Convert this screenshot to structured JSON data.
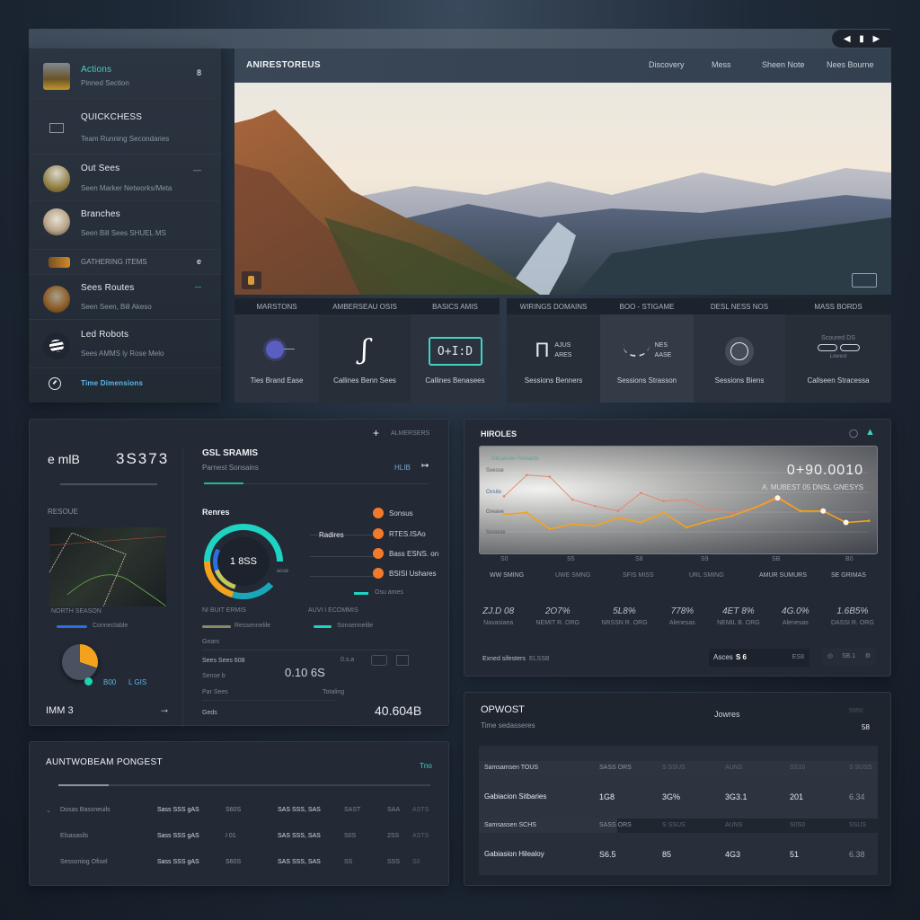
{
  "window": {
    "controls": [
      "prev",
      "stop",
      "next"
    ]
  },
  "sidebar": {
    "items": [
      {
        "title": "Actions",
        "subtitle": "Pinned Section",
        "badge": "8",
        "thumb": "cabin-photo",
        "accent": true
      },
      {
        "title": "QUICKCHESS",
        "subtitle": "Team Running Secondaries",
        "badge": "",
        "thumb": "device-icon"
      },
      {
        "title": "Out Sees",
        "subtitle": "Seen Marker Networks/Meta",
        "badge": "—",
        "thumb": "field-photo"
      },
      {
        "title": "Branches",
        "subtitle": "Seen Bill Sees SHUEL MS",
        "badge": "",
        "thumb": "tower-photo"
      },
      {
        "title": "GATHERING ITEMS",
        "subtitle": "",
        "badge": "e",
        "thumb": "campfire-photo",
        "small_caps": true
      },
      {
        "title": "Sees Routes",
        "subtitle": "Seen Seen, Bill Akeso",
        "badge": "—",
        "thumb": "market-photo"
      },
      {
        "title": "Led Robots",
        "subtitle": "Sees AMMS ly Rose Melo",
        "badge": "",
        "thumb": "stripe-logo"
      },
      {
        "title": "Time Dimensions",
        "subtitle": "",
        "badge": "",
        "thumb": "compass-icon",
        "link": true
      }
    ]
  },
  "header": {
    "title": "ANIRESTOREUS",
    "nav": [
      "Discovery",
      "Mess",
      "Sheen Note",
      "Nees Bourne"
    ]
  },
  "hero": {
    "alt": "Mountain valley with river at sunrise"
  },
  "tiles": [
    {
      "head": "MARSTONS",
      "label": "Ties Brand Ease",
      "icon": "sun-bulb-icon"
    },
    {
      "head": "AMBERSEAU OSIS",
      "label": "Callines Benn Sees",
      "icon": "hook-icon"
    },
    {
      "head": "BASICS AMIS",
      "label": "Callines Benasees",
      "icon": "display-icon",
      "display": "O+I:D"
    },
    {
      "head": "WIRINGS DOMAINS",
      "label": "Sessions Benners",
      "icon": "circuit-icon",
      "sub": [
        "AJUS",
        "ARES"
      ]
    },
    {
      "head": "BOO - STIGAME",
      "label": "Sessions Strasson",
      "icon": "ship-icon",
      "sub": [
        "NES",
        "AASE"
      ]
    },
    {
      "head": "DESL NESS NOS",
      "label": "Sessions Biens",
      "icon": "timer-icon"
    },
    {
      "head": "MASS BORDS",
      "label": "Callseen Stracessa",
      "icon": "chain-icon",
      "sub": [
        "Scoured DS",
        "Lowest"
      ]
    }
  ],
  "stats_panel": {
    "title": "e mlB",
    "big_value": "3S373",
    "section_label": "RESOUE",
    "map_caption": "NORTH SEASON",
    "map_legend": "Connectable",
    "pie_values": [
      "B00",
      "L GIS"
    ],
    "footer_label": "IMM 3",
    "add_label": "ALMERSERS",
    "gs_title": "GSL SRAMIS",
    "gs_subtitle": "Parnest Sonsains",
    "gs_value": "HLIB",
    "donut_title": "Renres",
    "donut_center": "1 8SS",
    "donut_slice_label": "acue",
    "legend_left_label": "Radires",
    "legend_items": [
      "Sonsus",
      "RTES.ISAo",
      "Bass ESNS. on",
      "BSISI Ushares"
    ],
    "legend_extra": "Osu ames",
    "mini_stats": [
      {
        "label": "NI BUIT ERMIS",
        "legend": "Ressennelile"
      },
      {
        "label": "AUVI I ECOMMIS",
        "legend": "Sonsennelile"
      }
    ],
    "rows_header": "Gears",
    "rows": [
      {
        "label": "Sees Sees 608"
      },
      {
        "label": "Sense b"
      },
      {
        "label": "Par Sees"
      }
    ],
    "mid_value": "0.10 6S",
    "toggle_label": "0.s.a",
    "tiny_label": "Totaling",
    "bottom_label": "Geds",
    "bottom_value": "40.604B"
  },
  "chart_panel": {
    "title": "HIROLES",
    "headline_value": "0+90.0010",
    "headline_sub": "A. MUBEST 05 DNSL GNESYS",
    "legend_title": "Oksannen Rewards",
    "stats": [
      {
        "value": "ZJ.D 08",
        "label": "Navasiaea"
      },
      {
        "value": "2O7%",
        "label": "NEMIT R. ORG"
      },
      {
        "value": "5L8%",
        "label": "NRSSN R. ORG"
      },
      {
        "value": "778%",
        "label": "Alenesas"
      },
      {
        "value": "4ET 8%",
        "label": "NEMIL B. ORG"
      },
      {
        "value": "4G.0%",
        "label": "Alenesas"
      },
      {
        "value": "1.6B5%",
        "label": "DASSI R. ORG"
      }
    ],
    "footer_left": "Exned sifesters",
    "footer_left_value": "ELSSB",
    "footer_input_label": "Asces",
    "footer_input_value": "S 6",
    "footer_input_hint": "ES8",
    "footer_right": "SB.1"
  },
  "chart_data": {
    "type": "line",
    "title": "Oksannen Rewards",
    "categories": [
      "WW SMING",
      "UWE SMNG",
      "SFIS MISS",
      "URL SMING",
      "AMUR SUMURS",
      "SE GRIMAS"
    ],
    "x_ticks": [
      "S0",
      "S5",
      "S8",
      "S9",
      "SB",
      "B0"
    ],
    "y_ticks": [
      "Svesse",
      "Ovsite",
      "Greave",
      "Scresse"
    ],
    "series": [
      {
        "name": "Series A",
        "color": "#e8856a",
        "values": [
          3.0,
          4.3,
          4.2,
          2.8,
          2.4,
          2.1,
          3.2,
          2.7,
          2.8,
          2.2,
          2.0,
          2.3,
          3.0,
          2.1,
          2.1,
          1.4,
          1.5
        ]
      },
      {
        "name": "Series B",
        "color": "#f4a21c",
        "values": [
          1.9,
          2.0,
          1.0,
          1.3,
          1.2,
          1.7,
          1.4,
          2.0,
          1.1,
          1.5,
          1.8,
          2.3,
          2.9,
          2.1,
          2.1,
          1.4,
          1.5
        ]
      }
    ],
    "ylim": [
      0,
      5
    ],
    "grid": true,
    "legend": "top-left"
  },
  "table_panel": {
    "title": "OPWOST",
    "subtitle": "Time sedasseres",
    "center_label": "Jowres",
    "right_hint": "5950",
    "right_value": "58",
    "sections": [
      {
        "header": [
          "Samsamsen TOUS",
          "SASS ORS",
          "S SSUS",
          "AUNS",
          "SS10",
          "S SUSS"
        ],
        "row": [
          "Gabiacion Sitbaries",
          "1G8",
          "3G%",
          "3G3.1",
          "201",
          "6.34"
        ]
      },
      {
        "header": [
          "Samsassen SCHS",
          "SASS ORS",
          "S SSUS",
          "AUNS",
          "S0S0",
          "SSUS"
        ],
        "row": [
          "Gabiasion Hilealoy",
          "S6.5",
          "85",
          "4G3",
          "51",
          "6.38"
        ]
      }
    ]
  },
  "bottom_left": {
    "title": "AUNTWOBEAM PONGEST",
    "link": "Tno",
    "rows": [
      {
        "name": "Dosas Bassneuils",
        "c1": "Sass SSS gAS",
        "c2": "S60S",
        "c3": "SAS SSS, SAS",
        "c4": "SAST",
        "c5": "SAA",
        "c6": "ASTS"
      },
      {
        "name": "Elsasasils",
        "c1": "Sass SSS gAS",
        "c2": "I 01",
        "c3": "SAS SSS, SAS",
        "c4": "S0S",
        "c5": "2SS",
        "c6": "ASTS"
      },
      {
        "name": "Sessoniog Ofisel",
        "c1": "Sass SSS gAS",
        "c2": "S60S",
        "c3": "SAS SSS, SAS",
        "c4": "SS",
        "c5": "SSS",
        "c6": "S0"
      }
    ]
  }
}
